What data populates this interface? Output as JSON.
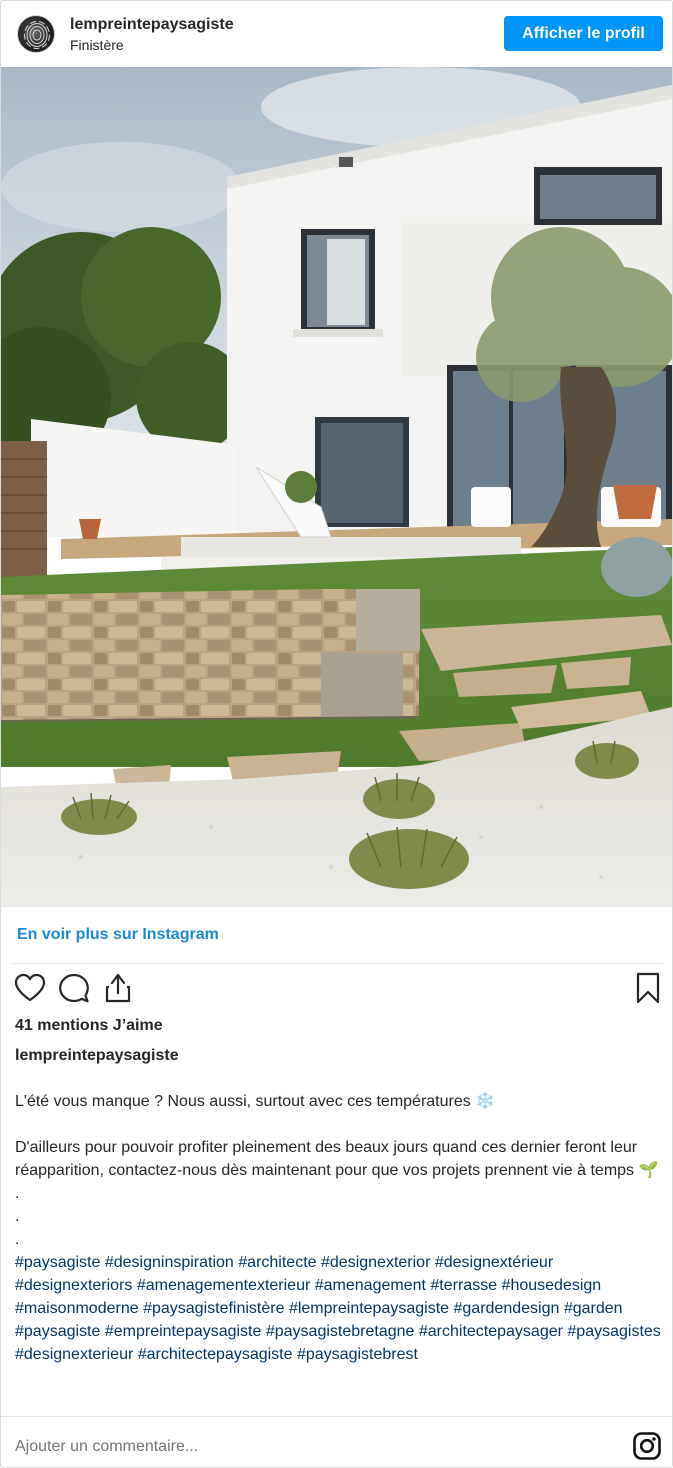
{
  "header": {
    "username": "lempreintepaysagiste",
    "location": "Finistère",
    "profile_button": "Afficher le profil"
  },
  "post": {
    "more_link": "En voir plus sur Instagram",
    "likes": "41 mentions J’aime",
    "caption_user": "lempreintepaysagiste",
    "caption_line1": "L'été vous manque ? Nous aussi, surtout avec ces températures ❄️",
    "caption_para2": "D'ailleurs pour pouvoir profiter pleinement des beaux jours quand ces dernier feront leur réapparition, contactez-nous dès maintenant pour que vos projets prennent vie à temps 🌱",
    "dots": [
      ".",
      ".",
      "."
    ],
    "hashtags": [
      "#paysagiste",
      "#designinspiration",
      "#architecte",
      "#designexterior",
      "#designextérieur",
      "#designexteriors",
      "#amenagementexterieur",
      "#amenagement",
      "#terrasse",
      "#housedesign",
      "#maisonmoderne",
      "#paysagistefinistère",
      "#lempreintepaysagiste",
      "#gardendesign",
      "#garden",
      "#paysagiste",
      "#empreintepaysagiste",
      "#paysagistebretagne",
      "#architectepaysager",
      "#paysagistes",
      "#designexterieur",
      "#architectepaysagiste",
      "#paysagistebrest"
    ],
    "comment_placeholder": "Ajouter un commentaire..."
  },
  "icons": {
    "like": "heart-icon",
    "comment": "comment-icon",
    "share": "share-icon",
    "save": "bookmark-icon",
    "instagram": "instagram-icon"
  },
  "colors": {
    "accent": "#0095f6",
    "link": "#1b8ad6",
    "hashtag": "#00376b"
  }
}
